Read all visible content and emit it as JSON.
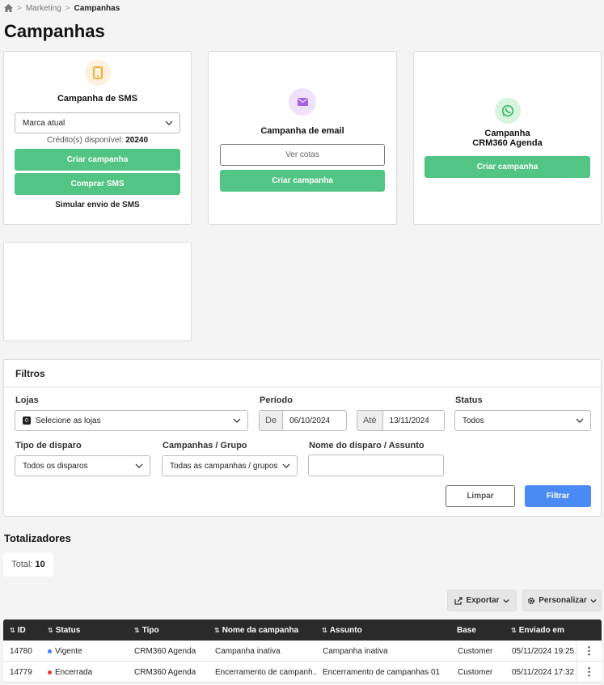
{
  "breadcrumb": {
    "marketing": "Marketing",
    "current": "Campanhas"
  },
  "page_title": "Campanhas",
  "sms_card": {
    "title": "Campanha de SMS",
    "brand_select": "Marca atual",
    "credits_label": "Crédito(s) disponível:",
    "credits_value": "20240",
    "create_button": "Criar campanha",
    "buy_button": "Comprar SMS",
    "simulate_link": "Simular envio de SMS",
    "icon": "phone-icon",
    "icon_color": "#f5a623"
  },
  "email_card": {
    "title": "Campanha de email",
    "quotas_button": "Ver cotas",
    "create_button": "Criar campanha",
    "icon": "envelope-icon",
    "icon_color": "#a463e0"
  },
  "whatsapp_card": {
    "title_line1": "Campanha",
    "title_line2": "CRM360 Agenda",
    "create_button": "Criar campanha",
    "icon": "whatsapp-icon",
    "icon_color": "#34b75e"
  },
  "filters": {
    "title": "Filtros",
    "stores_label": "Lojas",
    "stores_badge": "0",
    "stores_value": "Selecione as lojas",
    "period_label": "Período",
    "from_prefix": "De",
    "from_value": "06/10/2024",
    "to_prefix": "Até",
    "to_value": "13/11/2024",
    "status_label": "Status",
    "status_value": "Todos",
    "send_type_label": "Tipo de disparo",
    "send_type_value": "Todos os disparos",
    "campaigns_label": "Campanhas / Grupo",
    "campaigns_value": "Todas as campanhas / grupos",
    "name_label": "Nome do disparo / Assunto",
    "name_value": "",
    "clear_button": "Limpar",
    "filter_button": "Filtrar"
  },
  "totals": {
    "title": "Totalizadores",
    "total_label": "Total:",
    "total_value": "10"
  },
  "toolbar": {
    "export_label": "Exportar",
    "customize_label": "Personalizar"
  },
  "table": {
    "headers": {
      "id": "ID",
      "status": "Status",
      "type": "Tipo",
      "name": "Nome da campanha",
      "subject": "Assunto",
      "base": "Base",
      "sent": "Enviado em"
    },
    "rows": [
      {
        "id": "14780",
        "status": "Vigente",
        "status_color": "#3b82f6",
        "type": "CRM360 Agenda",
        "name": "Campanha inativa",
        "subject": "Campanha inativa",
        "base": "Customer",
        "sent": "05/11/2024 19:25"
      },
      {
        "id": "14779",
        "status": "Encerrada",
        "status_color": "#e53935",
        "type": "CRM360 Agenda",
        "name": "Encerramento de campanh...",
        "subject": "Encerramento de campanhas 01",
        "base": "Customer",
        "sent": "05/11/2024 17:32"
      }
    ]
  },
  "colors": {
    "primary_green": "#52c483",
    "primary_blue": "#4a8af4",
    "table_header": "#2a2a2a"
  }
}
